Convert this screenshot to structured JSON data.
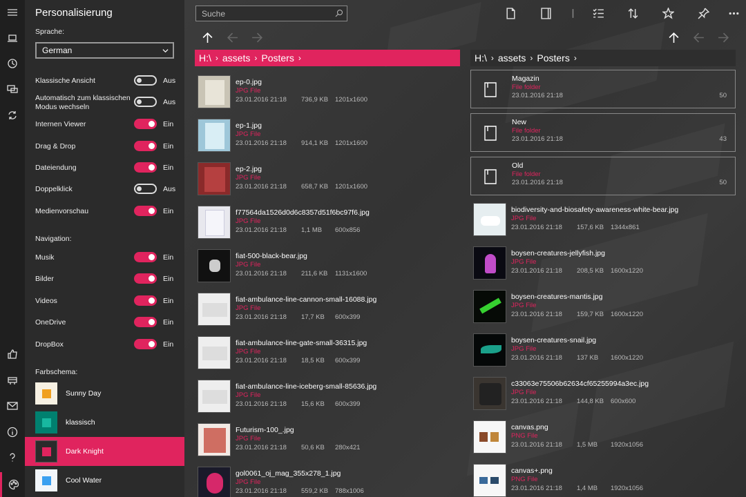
{
  "settings": {
    "title": "Personalisierung",
    "language_label": "Sprache:",
    "language_value": "German",
    "toggles": [
      {
        "label": "Klassische Ansicht",
        "state": "Aus",
        "on": false
      },
      {
        "label": "Automatisch zum klassischen Modus wechseln",
        "state": "Aus",
        "on": false
      },
      {
        "label": "Internen Viewer",
        "state": "Ein",
        "on": true
      },
      {
        "label": "Drag & Drop",
        "state": "Ein",
        "on": true
      },
      {
        "label": "Dateiendung",
        "state": "Ein",
        "on": true
      },
      {
        "label": "Doppelklick",
        "state": "Aus",
        "on": false
      },
      {
        "label": "Medienvorschau",
        "state": "Ein",
        "on": true
      }
    ],
    "navigation_label": "Navigation:",
    "nav_toggles": [
      {
        "label": "Musik",
        "state": "Ein",
        "on": true
      },
      {
        "label": "Bilder",
        "state": "Ein",
        "on": true
      },
      {
        "label": "Videos",
        "state": "Ein",
        "on": true
      },
      {
        "label": "OneDrive",
        "state": "Ein",
        "on": true
      },
      {
        "label": "DropBox",
        "state": "Ein",
        "on": true
      }
    ],
    "scheme_label": "Farbschema:",
    "schemes": [
      {
        "name": "Sunny Day",
        "bg": "#f7f1e3",
        "fg": "#f0a020",
        "selected": false
      },
      {
        "name": "klassisch",
        "bg": "#00806f",
        "fg": "#18b8a0",
        "selected": false
      },
      {
        "name": "Dark Knight",
        "bg": "#2b2b2b",
        "fg": "#e0245e",
        "selected": true
      },
      {
        "name": "Cool Water",
        "bg": "#f2f6fa",
        "fg": "#3aa0f0",
        "selected": false
      }
    ]
  },
  "rail_icons": [
    "hamburger-icon",
    "laptop-icon",
    "clock-icon",
    "screens-icon",
    "sync-icon",
    "thumbs-up-icon",
    "store-icon",
    "mail-icon",
    "info-icon",
    "help-icon",
    "palette-icon"
  ],
  "accent": "#e0245e",
  "search": {
    "placeholder": "Suche"
  },
  "left_pane": {
    "path": [
      "H:\\",
      "assets",
      "Posters"
    ],
    "files": [
      {
        "name": "ep-0.jpg",
        "type": "JPG File",
        "date": "23.01.2016 21:18",
        "size": "736,9 KB",
        "dims": "1201x1600"
      },
      {
        "name": "ep-1.jpg",
        "type": "JPG File",
        "date": "23.01.2016 21:18",
        "size": "914,1 KB",
        "dims": "1201x1600"
      },
      {
        "name": "ep-2.jpg",
        "type": "JPG File",
        "date": "23.01.2016 21:18",
        "size": "658,7 KB",
        "dims": "1201x1600"
      },
      {
        "name": "f77564da1526d0d6c8357d51f6bc97f6.jpg",
        "type": "JPG File",
        "date": "23.01.2016 21:18",
        "size": "1,1 MB",
        "dims": "600x856"
      },
      {
        "name": "fiat-500-black-bear.jpg",
        "type": "JPG File",
        "date": "23.01.2016 21:18",
        "size": "211,6 KB",
        "dims": "1131x1600"
      },
      {
        "name": "fiat-ambulance-line-cannon-small-16088.jpg",
        "type": "JPG File",
        "date": "23.01.2016 21:18",
        "size": "17,7 KB",
        "dims": "600x399"
      },
      {
        "name": "fiat-ambulance-line-gate-small-36315.jpg",
        "type": "JPG File",
        "date": "23.01.2016 21:18",
        "size": "18,5 KB",
        "dims": "600x399"
      },
      {
        "name": "fiat-ambulance-line-iceberg-small-85636.jpg",
        "type": "JPG File",
        "date": "23.01.2016 21:18",
        "size": "15,6 KB",
        "dims": "600x399"
      },
      {
        "name": "Futurism-100_.jpg",
        "type": "JPG File",
        "date": "23.01.2016 21:18",
        "size": "50,6 KB",
        "dims": "280x421"
      },
      {
        "name": "gol0061_oj_mag_355x278_1.jpg",
        "type": "JPG File",
        "date": "23.01.2016 21:18",
        "size": "559,2 KB",
        "dims": "788x1006"
      }
    ]
  },
  "right_pane": {
    "path": [
      "H:\\",
      "assets",
      "Posters"
    ],
    "folders": [
      {
        "name": "Magazin",
        "type": "File folder",
        "date": "23.01.2016 21:18",
        "count": "50"
      },
      {
        "name": "New",
        "type": "File folder",
        "date": "23.01.2016 21:18",
        "count": "43"
      },
      {
        "name": "Old",
        "type": "File folder",
        "date": "23.01.2016 21:18",
        "count": "50"
      }
    ],
    "files": [
      {
        "name": "biodiversity-and-biosafety-awareness-white-bear.jpg",
        "type": "JPG File",
        "date": "23.01.2016 21:18",
        "size": "157,6 KB",
        "dims": "1344x861"
      },
      {
        "name": "boysen-creatures-jellyfish.jpg",
        "type": "JPG File",
        "date": "23.01.2016 21:18",
        "size": "208,5 KB",
        "dims": "1600x1220"
      },
      {
        "name": "boysen-creatures-mantis.jpg",
        "type": "JPG File",
        "date": "23.01.2016 21:18",
        "size": "159,7 KB",
        "dims": "1600x1220"
      },
      {
        "name": "boysen-creatures-snail.jpg",
        "type": "JPG File",
        "date": "23.01.2016 21:18",
        "size": "137 KB",
        "dims": "1600x1220"
      },
      {
        "name": "c33063e75506b62634cf65255994a3ec.jpg",
        "type": "JPG File",
        "date": "23.01.2016 21:18",
        "size": "144,8 KB",
        "dims": "600x600"
      },
      {
        "name": "canvas.png",
        "type": "PNG File",
        "date": "23.01.2016 21:18",
        "size": "1,5 MB",
        "dims": "1920x1056"
      },
      {
        "name": "canvas+.png",
        "type": "PNG File",
        "date": "23.01.2016 21:18",
        "size": "1,4 MB",
        "dims": "1920x1056"
      }
    ]
  }
}
